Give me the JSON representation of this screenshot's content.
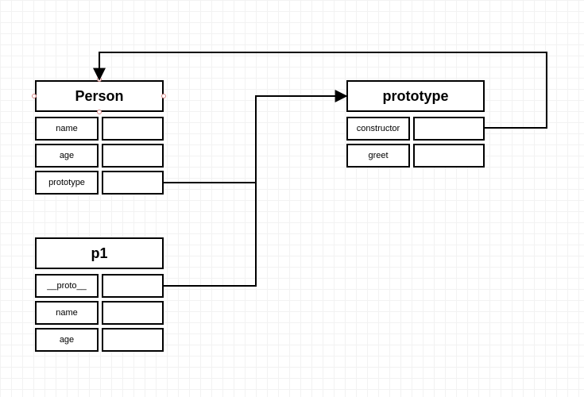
{
  "diagram": {
    "nodes": {
      "person": {
        "title": "Person",
        "rows": [
          {
            "key": "name",
            "value": ""
          },
          {
            "key": "age",
            "value": ""
          },
          {
            "key": "prototype",
            "value": ""
          }
        ]
      },
      "p1": {
        "title": "p1",
        "rows": [
          {
            "key": "__proto__",
            "value": ""
          },
          {
            "key": "name",
            "value": ""
          },
          {
            "key": "age",
            "value": ""
          }
        ]
      },
      "prototype": {
        "title": "prototype",
        "rows": [
          {
            "key": "constructor",
            "value": ""
          },
          {
            "key": "greet",
            "value": ""
          }
        ]
      }
    },
    "edges": [
      {
        "from": "person.prototype",
        "to": "prototype",
        "kind": "arrow"
      },
      {
        "from": "p1.__proto__",
        "to": "prototype",
        "kind": "merge"
      },
      {
        "from": "prototype.constructor",
        "to": "person",
        "kind": "arrow-loopback"
      }
    ]
  }
}
